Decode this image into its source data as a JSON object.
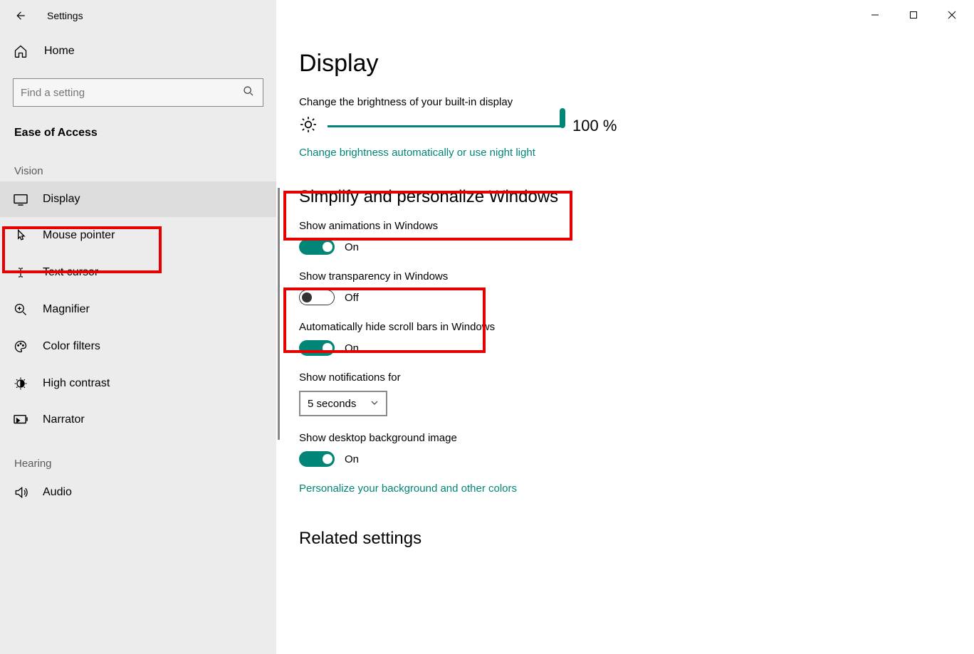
{
  "titlebar": {
    "app": "Settings"
  },
  "sidebar": {
    "home": "Home",
    "search_placeholder": "Find a setting",
    "category": "Ease of Access",
    "groups": [
      {
        "label": "Vision",
        "items": [
          {
            "label": "Display",
            "icon": "display",
            "active": true
          },
          {
            "label": "Mouse pointer",
            "icon": "pointer",
            "active": false
          },
          {
            "label": "Text cursor",
            "icon": "textcursor",
            "active": false
          },
          {
            "label": "Magnifier",
            "icon": "magnifier",
            "active": false
          },
          {
            "label": "Color filters",
            "icon": "palette",
            "active": false
          },
          {
            "label": "High contrast",
            "icon": "contrast",
            "active": false
          },
          {
            "label": "Narrator",
            "icon": "narrator",
            "active": false
          }
        ]
      },
      {
        "label": "Hearing",
        "items": [
          {
            "label": "Audio",
            "icon": "audio",
            "active": false
          }
        ]
      }
    ]
  },
  "main": {
    "title": "Display",
    "brightness": {
      "label": "Change the brightness of your built-in display",
      "value_pct": 100,
      "value_text": "100 %",
      "link": "Change brightness automatically or use night light"
    },
    "simplify": {
      "heading": "Simplify and personalize Windows",
      "settings": {
        "animations": {
          "label": "Show animations in Windows",
          "on": true,
          "text": "On"
        },
        "transparency": {
          "label": "Show transparency in Windows",
          "on": false,
          "text": "Off"
        },
        "scrollbars": {
          "label": "Automatically hide scroll bars in Windows",
          "on": true,
          "text": "On"
        },
        "notifications": {
          "label": "Show notifications for",
          "value": "5 seconds"
        },
        "background": {
          "label": "Show desktop background image",
          "on": true,
          "text": "On"
        }
      },
      "link": "Personalize your background and other colors"
    },
    "related_heading": "Related settings"
  }
}
